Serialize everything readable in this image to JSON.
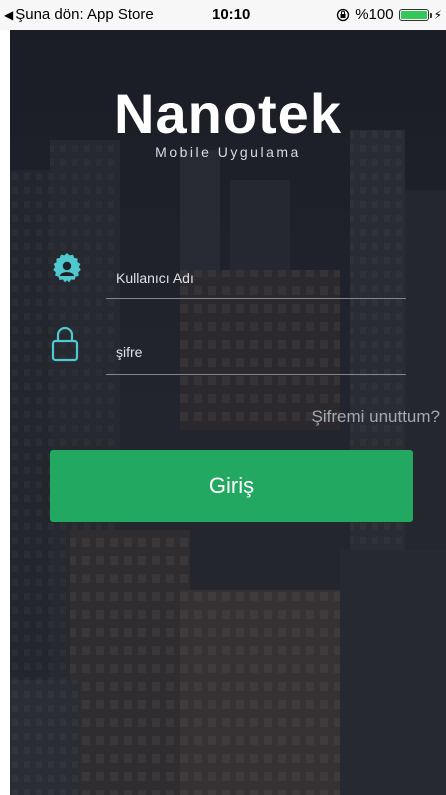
{
  "status_bar": {
    "back_label": "Şuna dön: App Store",
    "time": "10:10",
    "battery_text": "%100",
    "battery_level": 1.0
  },
  "app": {
    "logo": "Nanotek",
    "tagline": "Mobile Uygulama",
    "username_placeholder": "Kullanıcı Adı",
    "password_placeholder": "şifre",
    "forgot_password": "Şifremi unuttum?",
    "login_button": "Giriş"
  },
  "colors": {
    "accent_button": "#22a860",
    "icon_teal": "#4fc8d0",
    "background": "#1e2029"
  },
  "icons": {
    "user": "user-icon",
    "lock": "lock-icon",
    "back": "back-arrow-icon",
    "orientation_lock": "orientation-lock-icon",
    "battery": "battery-icon",
    "charging": "bolt-icon"
  }
}
